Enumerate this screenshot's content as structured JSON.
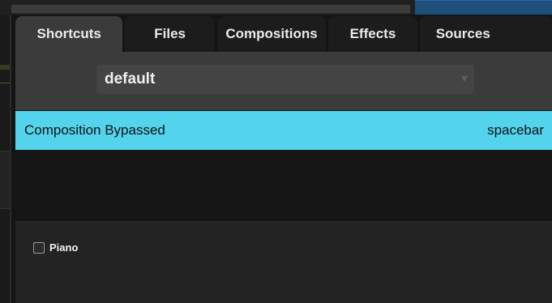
{
  "tabs": [
    {
      "label": "Shortcuts",
      "active": true
    },
    {
      "label": "Files",
      "active": false
    },
    {
      "label": "Compositions",
      "active": false
    },
    {
      "label": "Effects",
      "active": false
    },
    {
      "label": "Sources",
      "active": false
    }
  ],
  "preset_select": {
    "value": "default",
    "caret_icon": "chevron-down-icon"
  },
  "shortcuts_list": [
    {
      "action": "Composition Bypassed",
      "key": "spacebar",
      "selected": true
    }
  ],
  "options": {
    "piano": {
      "label": "Piano",
      "checked": false
    }
  },
  "colors": {
    "selection": "#54d4ec",
    "accent_blue": "#1e4f7b",
    "panel": "#3b3b3b",
    "background": "#141414"
  }
}
